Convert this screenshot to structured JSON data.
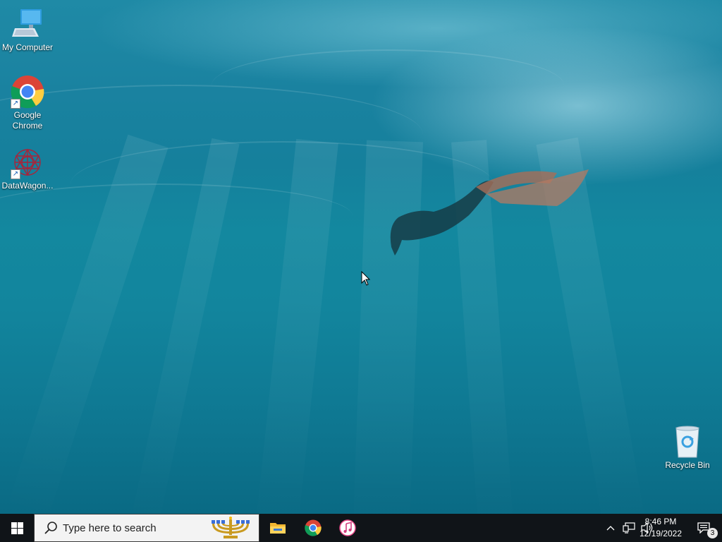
{
  "desktop": {
    "icons": [
      {
        "label": "My Computer",
        "icon": "computer-icon"
      },
      {
        "label": "Google Chrome",
        "icon": "chrome-icon"
      },
      {
        "label": "DataWagon...",
        "icon": "datawagon-icon"
      },
      {
        "label": "Recycle Bin",
        "icon": "recycle-bin-icon"
      }
    ]
  },
  "taskbar": {
    "start_icon": "windows-logo-icon",
    "search_placeholder": "Type here to search",
    "search_icon": "search-icon",
    "search_decoration": "menorah-icon",
    "pinned": [
      {
        "name": "File Explorer",
        "icon": "folder-icon"
      },
      {
        "name": "Google Chrome",
        "icon": "chrome-icon"
      },
      {
        "name": "iTunes",
        "icon": "itunes-icon"
      }
    ],
    "tray": {
      "chevron_icon": "chevron-up-icon",
      "network_icon": "network-icon",
      "volume_icon": "volume-icon",
      "time": "8:46 PM",
      "date": "12/19/2022",
      "notification_count": "3"
    }
  },
  "colors": {
    "taskbar": "#101418",
    "water_top": "#1f8aa6",
    "water_bottom": "#0a6a84"
  }
}
